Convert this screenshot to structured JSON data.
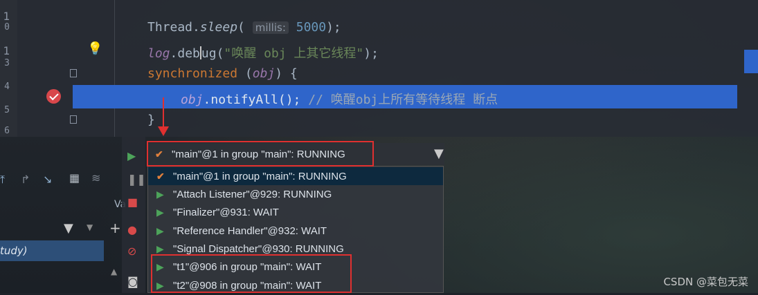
{
  "editor": {
    "line_numbers": [
      "1",
      "0",
      "1",
      "3",
      "4",
      "5",
      "6"
    ],
    "line1": {
      "prefix": "Thread.",
      "method": "sleep",
      "open": "( ",
      "hint": "millis:",
      "space": " ",
      "number": "5000",
      "suffix": ");"
    },
    "line2": {
      "field": "log",
      "dot": ".",
      "method_a": "deb",
      "method_b": "ug",
      "open": "(",
      "string": "\"唤醒 obj 上其它线程\"",
      "suffix": ");"
    },
    "line3": {
      "keyword": "synchronized",
      "open": " (",
      "field": "obj",
      "suffix": ") {"
    },
    "line4": {
      "field": "obj",
      "call": ".notifyAll();",
      "comment": " // 唤醒obj上所有等待线程 断点"
    },
    "line5": {
      "text": "}"
    }
  },
  "left_panel": {
    "va_label": "Va",
    "selected_item": "tudy)"
  },
  "thread_selector": {
    "current": "\"main\"@1 in group \"main\": RUNNING",
    "threads": [
      {
        "label": "\"main\"@1 in group \"main\": RUNNING",
        "icon": "check-icon"
      },
      {
        "label": "\"Attach Listener\"@929: RUNNING",
        "icon": "play-icon"
      },
      {
        "label": "\"Finalizer\"@931: WAIT",
        "icon": "play-icon"
      },
      {
        "label": "\"Reference Handler\"@932: WAIT",
        "icon": "play-icon"
      },
      {
        "label": "\"Signal Dispatcher\"@930: RUNNING",
        "icon": "play-icon"
      },
      {
        "label": "\"t1\"@906 in group \"main\": WAIT",
        "icon": "play-icon"
      },
      {
        "label": "\"t2\"@908 in group \"main\": WAIT",
        "icon": "play-icon"
      }
    ]
  },
  "watermark": "CSDN @菜包无菜",
  "colors": {
    "highlight": "#2f65ca",
    "annotation": "#e03030",
    "run_icon": "#4da35a"
  }
}
